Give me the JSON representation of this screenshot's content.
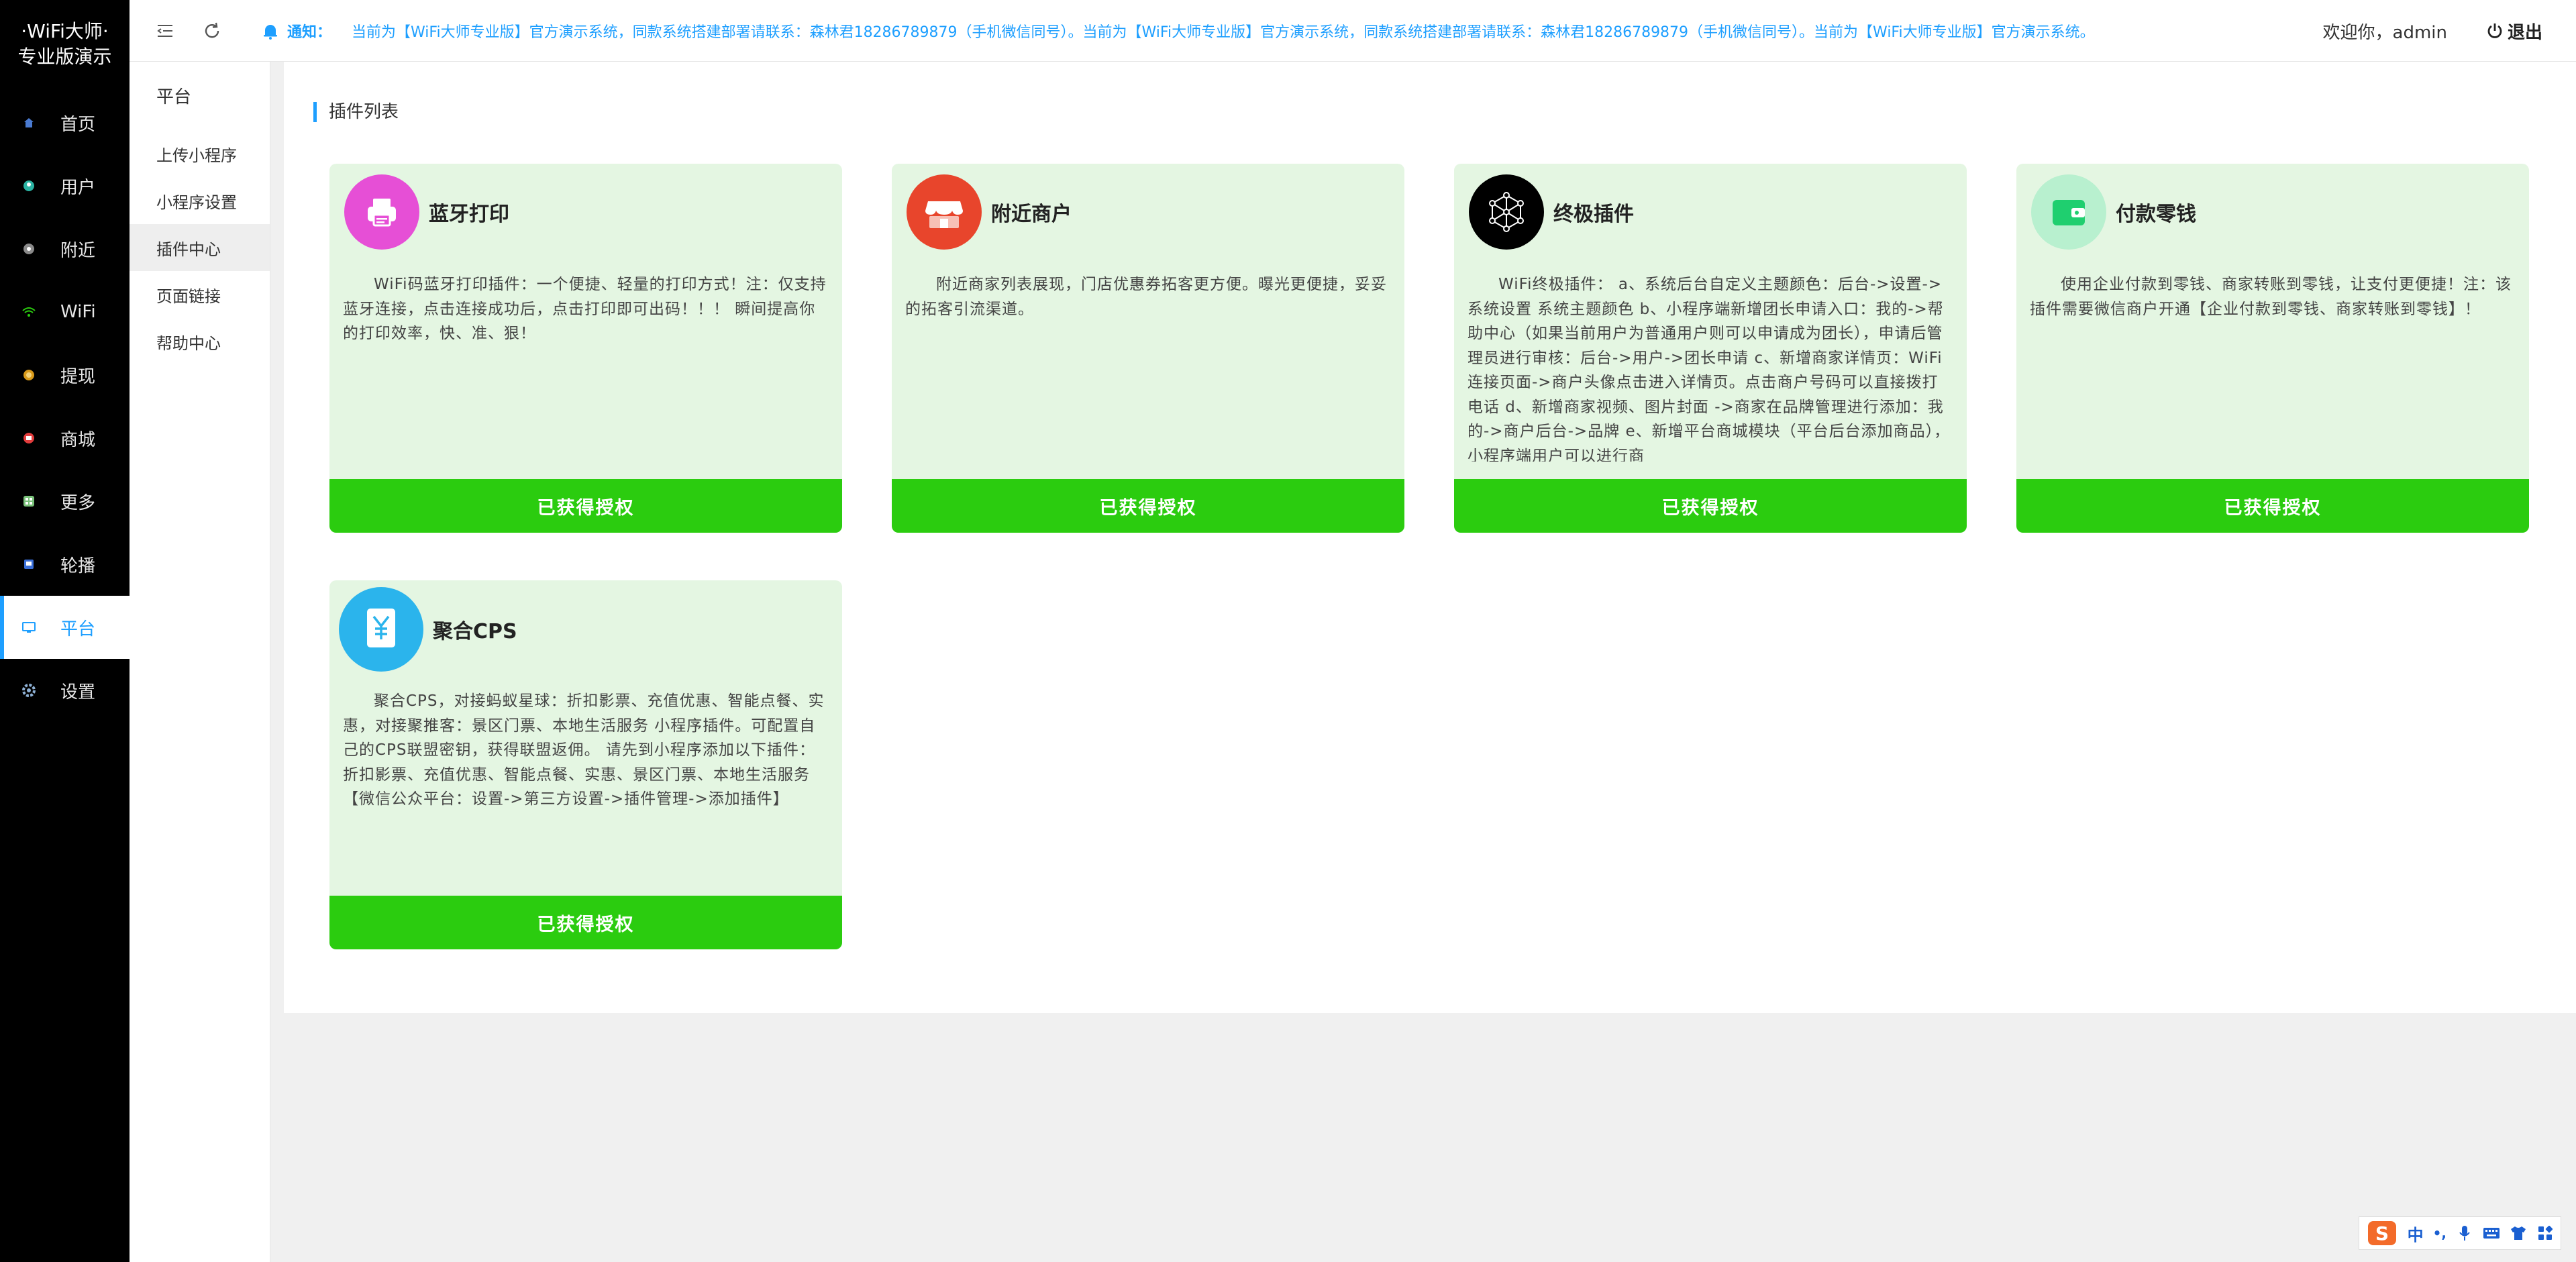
{
  "brand": {
    "line1": "·WiFi大师·",
    "line2": "专业版演示"
  },
  "nav": {
    "items": [
      {
        "label": "首页",
        "icon": "home-icon",
        "color": "#4a7bd1"
      },
      {
        "label": "用户",
        "icon": "user-icon",
        "color": "#2bb3a3"
      },
      {
        "label": "附近",
        "icon": "nearby-icon",
        "color": "#8a8a8a"
      },
      {
        "label": "WiFi",
        "icon": "wifi-icon",
        "color": "#2bcc0f"
      },
      {
        "label": "提现",
        "icon": "withdraw-icon",
        "color": "#d99a1a"
      },
      {
        "label": "商城",
        "icon": "mall-icon",
        "color": "#e23c3c"
      },
      {
        "label": "更多",
        "icon": "more-icon",
        "color": "#7ac27a"
      },
      {
        "label": "轮播",
        "icon": "carousel-icon",
        "color": "#3a6fd8"
      },
      {
        "label": "平台",
        "icon": "platform-icon",
        "color": "#1e9fff",
        "active": true
      },
      {
        "label": "设置",
        "icon": "settings-icon",
        "color": "#8fb2d6"
      }
    ]
  },
  "subnav": {
    "title": "平台",
    "items": [
      {
        "label": "上传小程序"
      },
      {
        "label": "小程序设置"
      },
      {
        "label": "插件中心",
        "active": true
      },
      {
        "label": "页面链接"
      },
      {
        "label": "帮助中心"
      }
    ]
  },
  "topbar": {
    "notice_label": "通知：",
    "notice_text": "当前为【WiFi大师专业版】官方演示系统，同款系统搭建部署请联系：森林君18286789879（手机微信同号）。当前为【WiFi大师专业版】官方演示系统，同款系统搭建部署请联系：森林君18286789879（手机微信同号）。当前为【WiFi大师专业版】官方演示系统。",
    "welcome": "欢迎你，admin",
    "logout": "退出"
  },
  "main": {
    "section_title": "插件列表",
    "cards": [
      {
        "title": "蓝牙打印",
        "icon": "printer-icon",
        "icon_color": "#e64fd6",
        "desc": "WiFi码蓝牙打印插件：一个便捷、轻量的打印方式！注：仅支持蓝牙连接，点击连接成功后，点击打印即可出码！！！ 瞬间提高你的打印效率，快、准、狠！",
        "button": "已获得授权"
      },
      {
        "title": "附近商户",
        "icon": "store-icon",
        "icon_color": "#e8452c",
        "desc": "附近商家列表展现，门店优惠券拓客更方便。曝光更便捷，妥妥的拓客引流渠道。",
        "button": "已获得授权"
      },
      {
        "title": "终极插件",
        "icon": "network-icon",
        "icon_color": "#000000",
        "desc": "WiFi终极插件： a、系统后台自定义主题颜色：后台->设置->系统设置 系统主题颜色 b、小程序端新增团长申请入口：我的->帮助中心（如果当前用户为普通用户则可以申请成为团长），申请后管理员进行审核：后台->用户->团长申请 c、新增商家详情页：WiFi连接页面->商户头像点击进入详情页。点击商户号码可以直接拨打电话 d、新增商家视频、图片封面 ->商家在品牌管理进行添加：我的->商户后台->品牌 e、新增平台商城模块（平台后台添加商品），小程序端用户可以进行商",
        "button": "已获得授权"
      },
      {
        "title": "付款零钱",
        "icon": "wallet-icon",
        "icon_color": "#2bcf7a",
        "desc": "使用企业付款到零钱、商家转账到零钱，让支付更便捷！注：该插件需要微信商户开通【企业付款到零钱、商家转账到零钱】！",
        "button": "已获得授权"
      },
      {
        "title": "聚合CPS",
        "icon": "cps-icon",
        "icon_color": "#2bb4ec",
        "desc": "聚合CPS，对接蚂蚁星球：折扣影票、充值优惠、智能点餐、实惠，对接聚推客：景区门票、本地生活服务 小程序插件。可配置自己的CPS联盟密钥，获得联盟返佣。 请先到小程序添加以下插件：折扣影票、充值优惠、智能点餐、实惠、景区门票、本地生活服务【微信公众平台：设置->第三方设置->插件管理->添加插件】",
        "button": "已获得授权"
      }
    ]
  },
  "ime": {
    "s_label": "S",
    "mode": "中",
    "punct": "•,",
    "mic": "mic-icon",
    "keyboard": "keyboard-icon",
    "skin": "skin-icon",
    "grid": "grid-icon"
  }
}
